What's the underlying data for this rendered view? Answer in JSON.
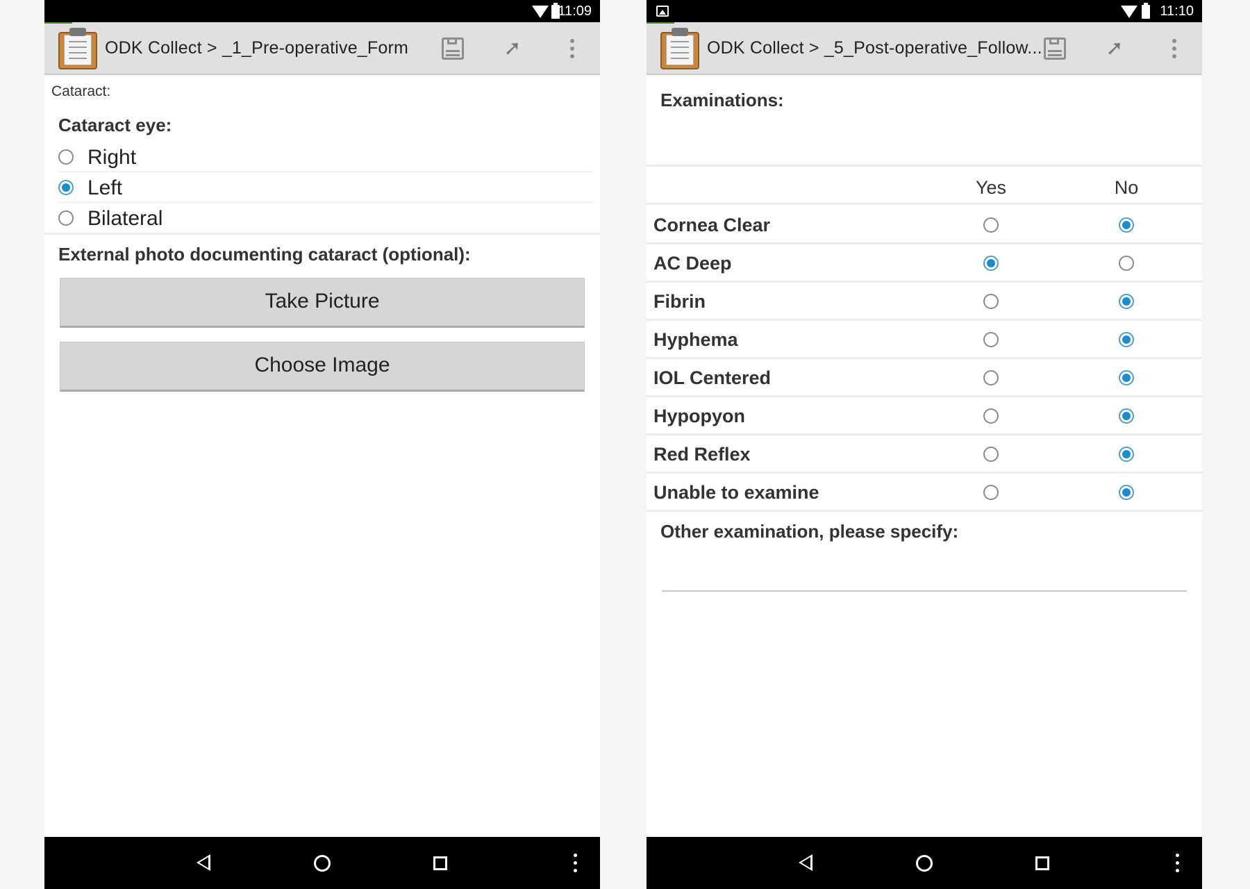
{
  "left": {
    "status": {
      "time": "11:09"
    },
    "actionbar": {
      "title": "ODK Collect > _1_Pre-operative_Form"
    },
    "group_label": "Cataract:",
    "question": {
      "label": "Cataract eye:",
      "options": [
        {
          "label": "Right",
          "selected": false
        },
        {
          "label": "Left",
          "selected": true
        },
        {
          "label": "Bilateral",
          "selected": false
        }
      ]
    },
    "photo_question": {
      "label": "External photo documenting cataract (optional):",
      "take_picture_label": "Take Picture",
      "choose_image_label": "Choose Image"
    }
  },
  "right": {
    "status": {
      "time": "11:10"
    },
    "actionbar": {
      "title": "ODK Collect > _5_Post-operative_Follow..."
    },
    "exam_label": "Examinations:",
    "columns": [
      "Yes",
      "No"
    ],
    "rows": [
      {
        "label": "Cornea Clear",
        "value": "No"
      },
      {
        "label": "AC Deep",
        "value": "Yes"
      },
      {
        "label": "Fibrin",
        "value": "No"
      },
      {
        "label": "Hyphema",
        "value": "No"
      },
      {
        "label": "IOL Centered",
        "value": "No"
      },
      {
        "label": "Hypopyon",
        "value": "No"
      },
      {
        "label": "Red Reflex",
        "value": "No"
      },
      {
        "label": "Unable to examine",
        "value": "No"
      }
    ],
    "other_label": "Other examination, please specify:",
    "other_value": ""
  },
  "colors": {
    "accent": "#1e8ccc",
    "statusbar": "#000000",
    "actionbar": "#e0e0e0",
    "button": "#d6d6d6"
  }
}
